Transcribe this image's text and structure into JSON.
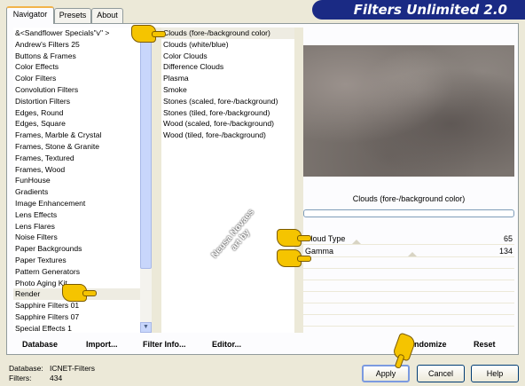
{
  "tabs": [
    "Navigator",
    "Presets",
    "About"
  ],
  "app_title": "Filters Unlimited 2.0",
  "categories": [
    "&<Sandflower Specials\"v\" >",
    "Andrew's Filters 25",
    "Buttons & Frames",
    "Color Effects",
    "Color Filters",
    "Convolution Filters",
    "Distortion Filters",
    "Edges, Round",
    "Edges, Square",
    "Frames, Marble & Crystal",
    "Frames, Stone & Granite",
    "Frames, Textured",
    "Frames, Wood",
    "FunHouse",
    "Gradients",
    "Image Enhancement",
    "Lens Effects",
    "Lens Flares",
    "Noise Filters",
    "Paper Backgrounds",
    "Paper Textures",
    "Pattern Generators",
    "Photo Aging Kit",
    "Render",
    "Sapphire Filters 01",
    "Sapphire Filters 07",
    "Special Effects 1"
  ],
  "selected_category_index": 23,
  "filters": [
    "Clouds (fore-/background color)",
    "Clouds (white/blue)",
    "Color Clouds",
    "Difference Clouds",
    "Plasma",
    "Smoke",
    "Stones (scaled, fore-/background)",
    "Stones (tiled, fore-/background)",
    "Wood (scaled, fore-/background)",
    "Wood (tiled, fore-/background)"
  ],
  "selected_filter_index": 0,
  "preview_title": "Clouds (fore-/background color)",
  "params": [
    {
      "label": "Cloud Type",
      "value": "65"
    },
    {
      "label": "Gamma",
      "value": "134"
    }
  ],
  "toolbar": {
    "database": "Database",
    "import": "Import...",
    "filter_info": "Filter Info...",
    "editor": "Editor...",
    "randomize": "ndomize",
    "reset": "Reset"
  },
  "status": {
    "database_label": "Database:",
    "database_value": "ICNET-Filters",
    "filters_label": "Filters:",
    "filters_value": "434"
  },
  "buttons": {
    "apply": "Apply",
    "cancel": "Cancel",
    "help": "Help"
  },
  "watermark": "Neusa Novaes art by"
}
